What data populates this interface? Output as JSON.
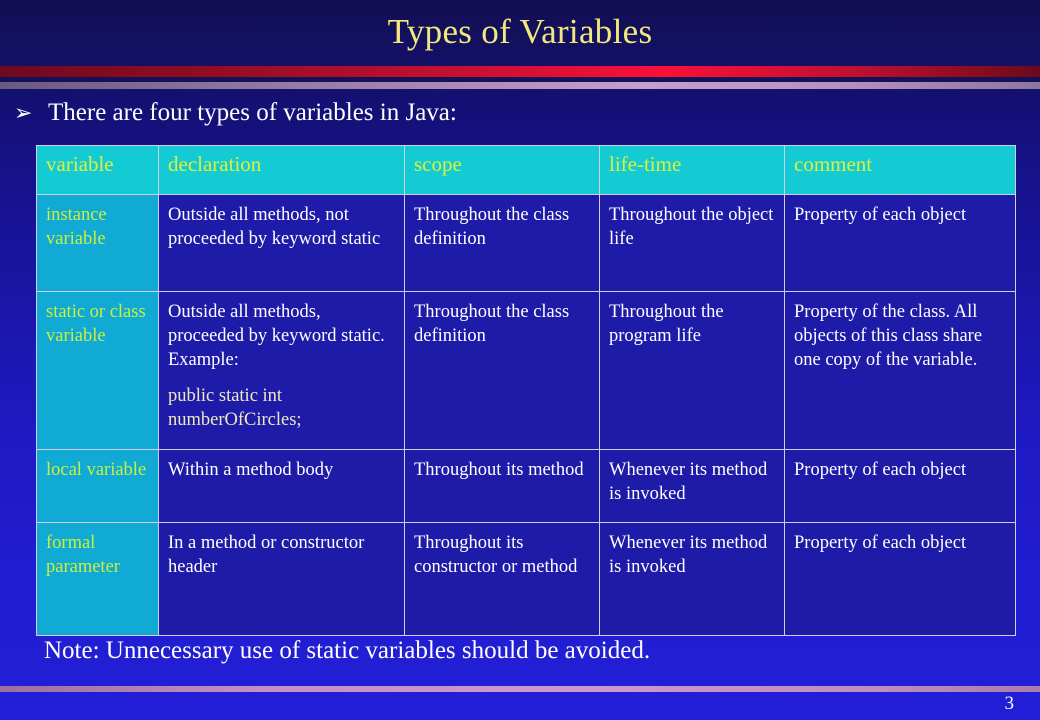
{
  "slide": {
    "title": "Types of Variables",
    "number": "3",
    "intro_bullet_icon": "arrowhead-bullet-icon",
    "intro_bullet_glyph": "➢",
    "intro_text": "There are four types of variables in Java:",
    "note": "Note: Unnecessary use of static variables should be avoided."
  },
  "colors": {
    "title_text": "#F2E97E",
    "header_bg": "#15CBD3",
    "header_text": "#DCF03C",
    "kind_cell_bg": "#11AAD4",
    "kind_cell_text": "#C8F03C",
    "body_cell_bg": "#1E1BA8",
    "body_cell_text": "#FFFFFF",
    "code_text": "#EFE9C2",
    "border": "#CFCFEA",
    "accent_red": "#FA1038",
    "accent_mauve": "#C89ECB"
  },
  "table": {
    "headers": [
      "variable",
      "declaration",
      "scope",
      "life-time",
      "comment"
    ],
    "rows": [
      {
        "variable": "instance variable",
        "declaration": "Outside all methods, not proceeded by keyword static",
        "declaration_code": null,
        "scope": "Throughout the class definition",
        "lifetime": "Throughout the object life",
        "comment": "Property of each object"
      },
      {
        "variable": "static or class variable",
        "declaration": "Outside all methods, proceeded by keyword static. Example:",
        "declaration_code": [
          "public static int",
          "numberOfCircles;"
        ],
        "scope": "Throughout the class definition",
        "lifetime": "Throughout the program life",
        "comment": "Property of the class. All objects of this class share one copy of the variable."
      },
      {
        "variable": "local variable",
        "declaration": "Within a method body",
        "declaration_code": null,
        "scope": "Throughout its method",
        "lifetime": "Whenever its method is invoked",
        "comment": "Property of each object"
      },
      {
        "variable": "formal parameter",
        "declaration": "In a method or constructor header",
        "declaration_code": null,
        "scope": "Throughout its constructor or method",
        "lifetime": "Whenever its method is invoked",
        "comment": "Property of each object"
      }
    ]
  }
}
